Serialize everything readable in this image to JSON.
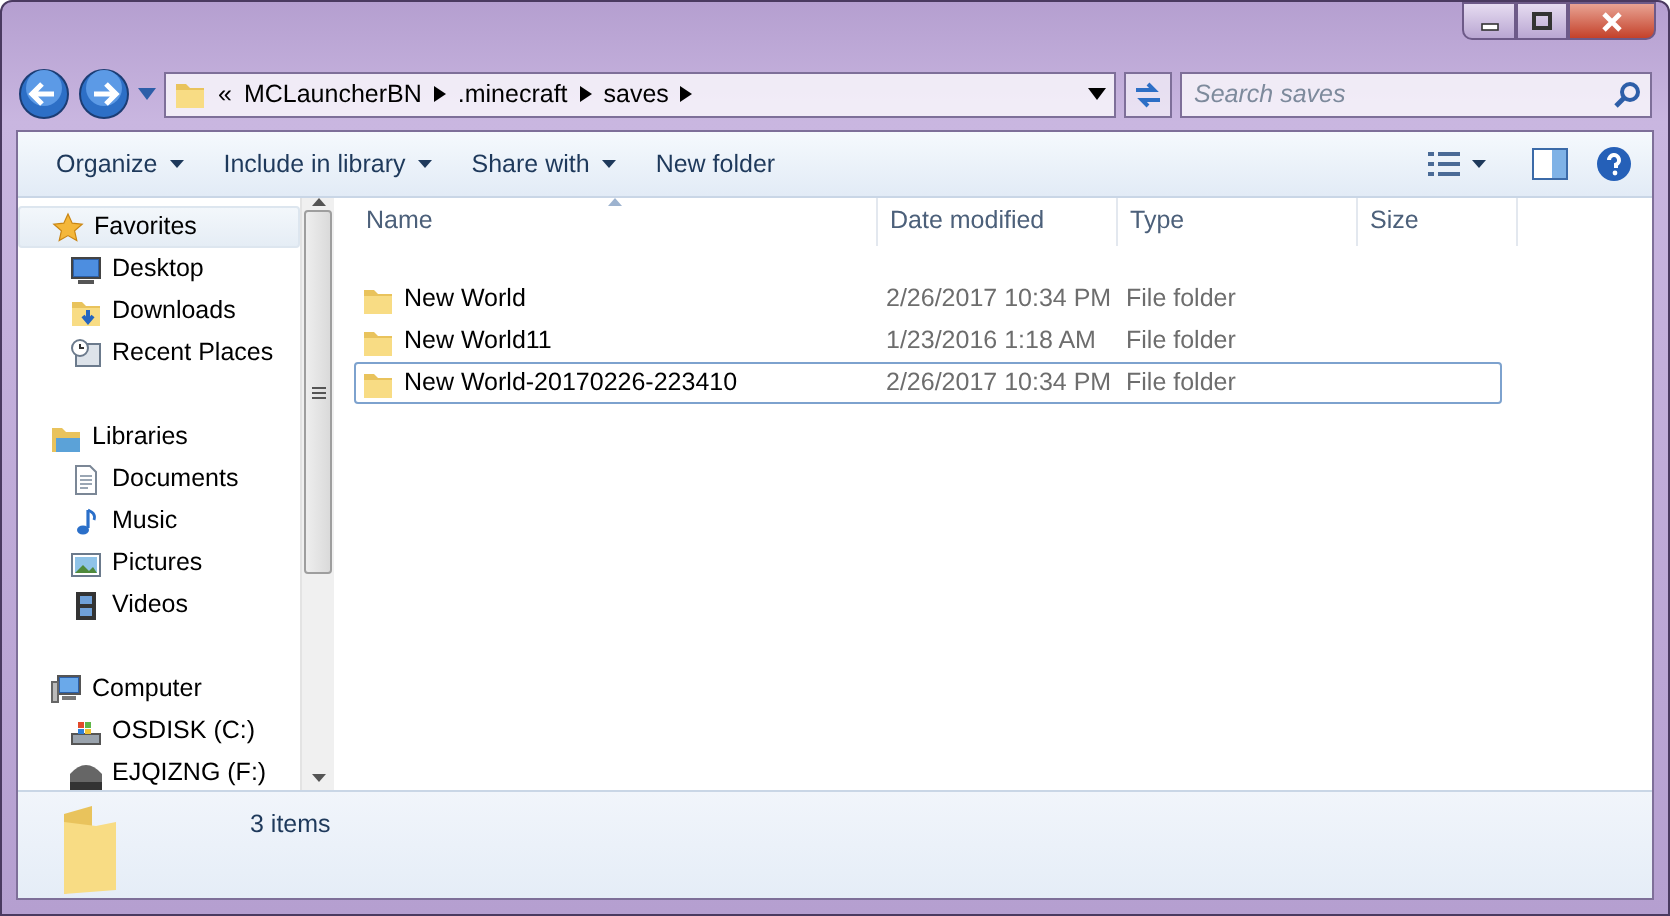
{
  "address": {
    "prefix": "«",
    "crumbs": [
      "MCLauncherBN",
      ".minecraft",
      "saves"
    ]
  },
  "search": {
    "placeholder": "Search saves"
  },
  "toolbar": [
    {
      "label": "Organize",
      "has_menu": true
    },
    {
      "label": "Include in library",
      "has_menu": true
    },
    {
      "label": "Share with",
      "has_menu": true
    },
    {
      "label": "New folder",
      "has_menu": false
    }
  ],
  "sidebar": [
    {
      "label": "Favorites",
      "kind": "favorites",
      "selected": true,
      "children": [
        {
          "label": "Desktop",
          "kind": "desktop",
          "selected": false
        },
        {
          "label": "Downloads",
          "kind": "downloads",
          "selected": false
        },
        {
          "label": "Recent Places",
          "kind": "recent",
          "selected": false
        }
      ]
    },
    {
      "label": "Libraries",
      "kind": "libraries",
      "selected": false,
      "children": [
        {
          "label": "Documents",
          "kind": "documents",
          "selected": false
        },
        {
          "label": "Music",
          "kind": "music",
          "selected": false
        },
        {
          "label": "Pictures",
          "kind": "pictures",
          "selected": false
        },
        {
          "label": "Videos",
          "kind": "videos",
          "selected": false
        }
      ]
    },
    {
      "label": "Computer",
      "kind": "computer",
      "selected": false,
      "children": [
        {
          "label": "OSDISK (C:)",
          "kind": "disk",
          "selected": false
        },
        {
          "label": "EJQIZNG (F:)",
          "kind": "drive",
          "selected": false
        }
      ]
    }
  ],
  "table": {
    "columns": [
      "Name",
      "Date modified",
      "Type",
      "Size"
    ],
    "rows": [
      {
        "name": "New World",
        "date": "2/26/2017 10:34 PM",
        "type": "File folder",
        "selected": false
      },
      {
        "name": "New World11",
        "date": "1/23/2016 1:18 AM",
        "type": "File folder",
        "selected": false
      },
      {
        "name": "New World-20170226-223410",
        "date": "2/26/2017 10:34 PM",
        "type": "File folder",
        "selected": true
      }
    ]
  },
  "status_bar": {
    "text": "3 items"
  }
}
